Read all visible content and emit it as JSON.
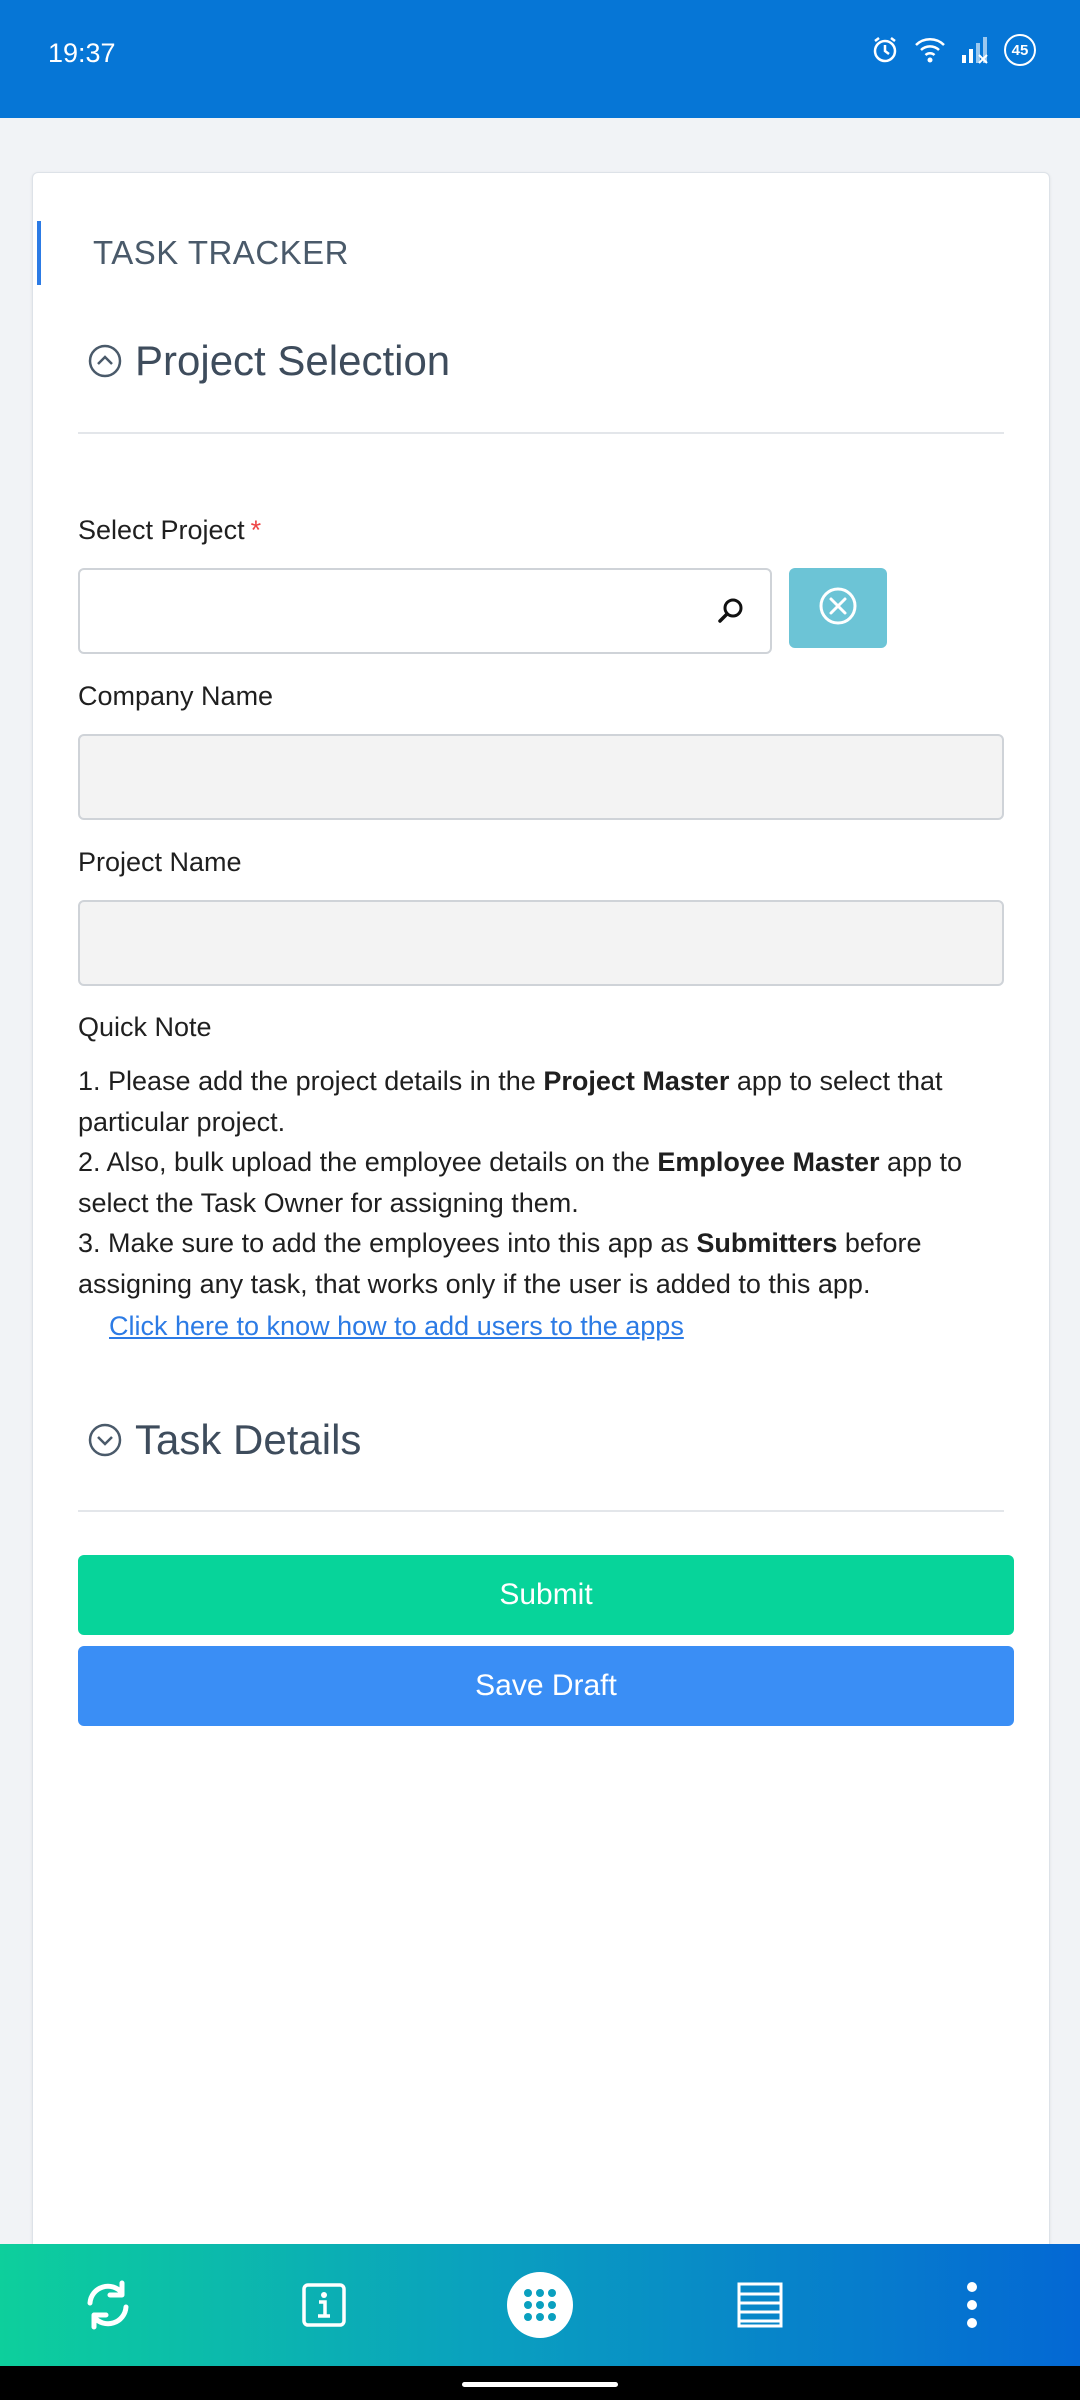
{
  "status_bar": {
    "time": "19:37",
    "icons": [
      "alarm-icon",
      "wifi-icon",
      "signal-icon",
      "battery-icon"
    ],
    "battery_level": "45"
  },
  "app": {
    "title": "TASK TRACKER"
  },
  "sections": {
    "project_selection": {
      "title": "Project Selection",
      "expanded": true
    },
    "task_details": {
      "title": "Task Details",
      "expanded": false
    }
  },
  "form": {
    "select_project": {
      "label": "Select Project",
      "required_mark": "*",
      "value": "",
      "placeholder": ""
    },
    "company_name": {
      "label": "Company Name",
      "value": ""
    },
    "project_name": {
      "label": "Project Name",
      "value": ""
    }
  },
  "quick_note": {
    "label": "Quick Note",
    "line1_a": "1. Please add the project details in the ",
    "line1_bold": "Project Master",
    "line1_b": " app to select that particular project.",
    "line2_a": "2. Also, bulk upload the employee details on the ",
    "line2_bold": "Employee Master",
    "line2_b": " app to select the Task Owner for assigning them.",
    "line3_a": "3. Make sure to add the employees into this app as ",
    "line3_bold": "Submitters",
    "line3_b": " before assigning any task, that works only if the user is added to this app.",
    "link": "Click here to know how to add users to the apps"
  },
  "buttons": {
    "submit": "Submit",
    "save_draft": "Save Draft"
  },
  "bottom_nav": {
    "items": [
      "refresh-icon",
      "info-icon",
      "apps-grid-icon",
      "list-icon",
      "more-vertical-icon"
    ]
  },
  "colors": {
    "status_bar": "#0676d6",
    "accent": "#2c7be5",
    "submit": "#07d49a",
    "save_draft": "#3a8ef5",
    "clear_button": "#6cc4d6"
  }
}
